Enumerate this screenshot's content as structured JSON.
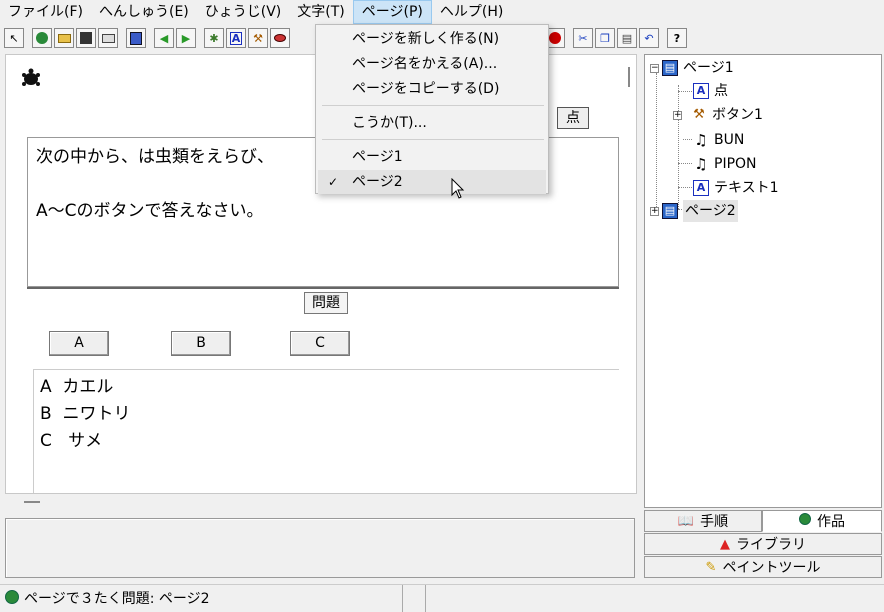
{
  "menubar": {
    "items": [
      {
        "label": "ファイル(F)"
      },
      {
        "label": "へんしゅう(E)"
      },
      {
        "label": "ひょうじ(V)"
      },
      {
        "label": "文字(T)"
      },
      {
        "label": "ページ(P)"
      },
      {
        "label": "ヘルプ(H)"
      }
    ]
  },
  "page_menu": {
    "items": [
      {
        "label": "ページを新しく作る(N)"
      },
      {
        "label": "ページ名をかえる(A)..."
      },
      {
        "label": "ページをコピーする(D)"
      },
      {
        "label": "こうか(T)..."
      },
      {
        "label": "ページ1"
      },
      {
        "label": "ページ2",
        "checked_mark": "✓"
      }
    ]
  },
  "canvas": {
    "score_button": "点",
    "question_lines": [
      "次の中から、は虫類をえらび、",
      "",
      "A〜Cのボタンで答えなさい。"
    ],
    "mondai_label": "問題",
    "answer_buttons": [
      "A",
      "B",
      "C"
    ],
    "choices": [
      "A  カエル",
      "B  ニワトリ",
      "C   サメ"
    ]
  },
  "tree": {
    "page1": "ページ1",
    "children": [
      "点",
      "ボタン1",
      "BUN",
      "PIPON",
      "テキスト1"
    ],
    "page2": "ページ2",
    "expand_symbol_open": "−",
    "expand_symbol_closed": "+"
  },
  "tabs": {
    "steps": "手順",
    "works": "作品",
    "library": "ライブラリ",
    "paint": "ペイントツール"
  },
  "toolbar": {
    "help": "?",
    "text_tool": "A"
  },
  "status": {
    "text": "ページで３たく問題: ページ2"
  }
}
